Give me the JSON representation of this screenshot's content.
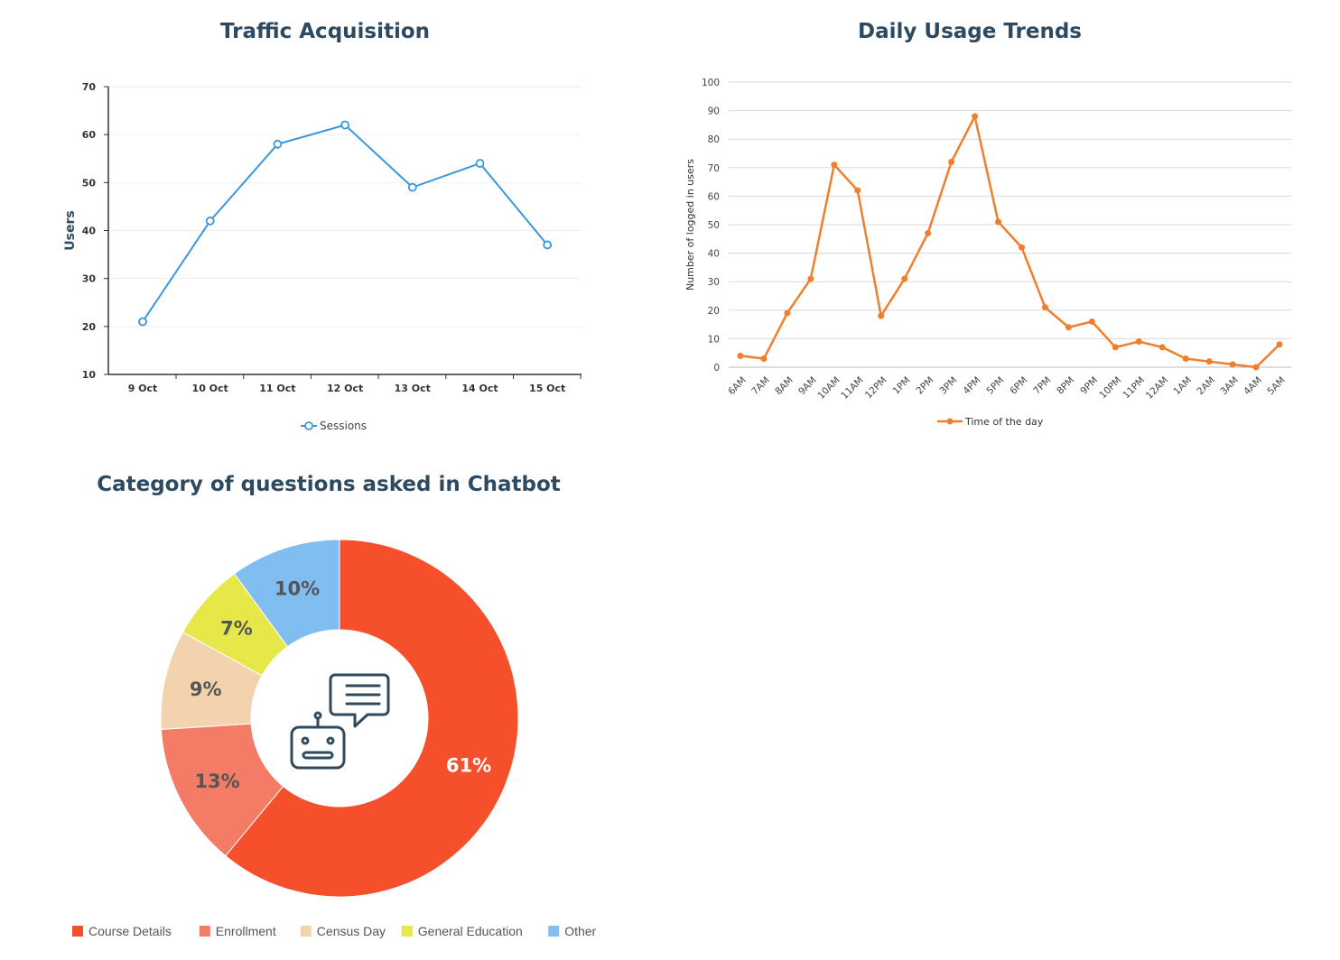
{
  "chart_data": [
    {
      "type": "line",
      "title": "Traffic Acquisition",
      "xlabel": "",
      "ylabel": "Users",
      "categories": [
        "9 Oct",
        "10 Oct",
        "11 Oct",
        "12 Oct",
        "13 Oct",
        "14 Oct",
        "15 Oct"
      ],
      "series": [
        {
          "name": "Sessions",
          "values": [
            21,
            42,
            58,
            62,
            49,
            54,
            37
          ]
        }
      ],
      "ylim": [
        10,
        70
      ],
      "yticks": [
        10,
        20,
        30,
        40,
        50,
        60,
        70
      ],
      "grid": true,
      "legend": "bottom",
      "color": "#3a97dd"
    },
    {
      "type": "line",
      "title": "Daily Usage Trends",
      "xlabel": "",
      "ylabel": "Number of logged in users",
      "categories": [
        "6AM",
        "7AM",
        "8AM",
        "9AM",
        "10AM",
        "11AM",
        "12PM",
        "1PM",
        "2PM",
        "3PM",
        "4PM",
        "5PM",
        "6PM",
        "7PM",
        "8PM",
        "9PM",
        "10PM",
        "11PM",
        "12AM",
        "1AM",
        "2AM",
        "3AM",
        "4AM",
        "5AM"
      ],
      "series": [
        {
          "name": "Time of the day",
          "values": [
            4,
            3,
            19,
            31,
            71,
            62,
            18,
            31,
            47,
            72,
            88,
            51,
            42,
            21,
            14,
            16,
            7,
            9,
            7,
            3,
            2,
            1,
            0,
            8
          ]
        }
      ],
      "ylim": [
        0,
        100
      ],
      "yticks": [
        0,
        10,
        20,
        30,
        40,
        50,
        60,
        70,
        80,
        90,
        100
      ],
      "grid": true,
      "legend": "bottom",
      "color": "#ef7f2d"
    },
    {
      "type": "pie",
      "title": "Category of questions asked in Chatbot",
      "categories": [
        "Course Details",
        "Enrollment",
        "Census Day",
        "General Education",
        "Other"
      ],
      "values": [
        61,
        13,
        9,
        7,
        10
      ],
      "labels": [
        "61%",
        "13%",
        "9%",
        "7%",
        "10%"
      ],
      "colors": [
        "#f54f2b",
        "#f47c66",
        "#f2d3ae",
        "#e6e84a",
        "#80bdf0"
      ],
      "legend": "bottom",
      "donut": true,
      "center_icon": "chatbot-icon"
    }
  ]
}
